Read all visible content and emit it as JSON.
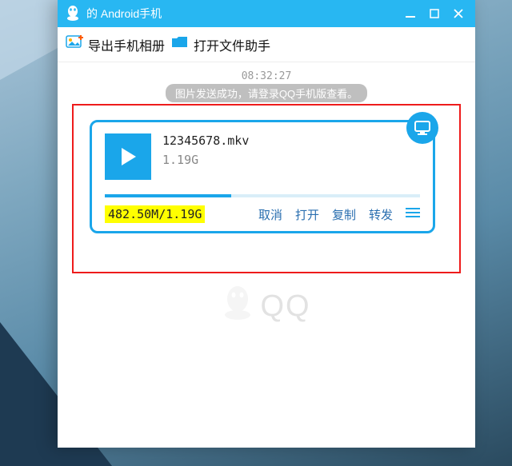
{
  "window": {
    "title_prefix": "",
    "title_suffix": "的 Android手机"
  },
  "toolbar": {
    "export_label": "导出手机相册",
    "open_helper_label": "打开文件助手"
  },
  "chat": {
    "timestamp": "08:32:27",
    "status_text": "图片发送成功，请登录QQ手机版查看。"
  },
  "file": {
    "name": "12345678.mkv",
    "size": "1.19G",
    "progress_text": "482.50M/1.19G",
    "progress_ratio": 0.4
  },
  "actions": {
    "cancel": "取消",
    "open": "打开",
    "copy": "复制",
    "forward": "转发"
  },
  "watermark": {
    "text": "QQ"
  },
  "colors": {
    "accent": "#1aa6ea",
    "highlight_border": "#ee1b1b",
    "progress_highlight": "#ffff00"
  }
}
